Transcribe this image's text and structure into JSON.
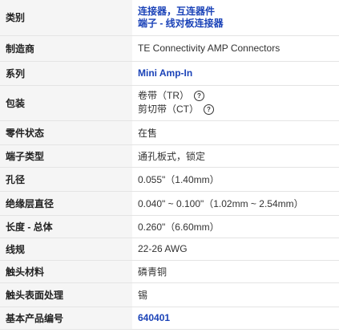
{
  "rows": [
    {
      "label": "类别",
      "links": [
        "连接器，互连器件",
        "端子 - 线对板连接器"
      ]
    },
    {
      "label": "制造商",
      "value": "TE Connectivity AMP Connectors"
    },
    {
      "label": "系列",
      "value": "Mini Amp-In"
    },
    {
      "label": "包装",
      "packaging": [
        "卷带（TR）",
        "剪切带（CT）"
      ],
      "help_icon": "question-circle-icon"
    },
    {
      "label": "零件状态",
      "value": "在售"
    },
    {
      "label": "端子类型",
      "value": "通孔板式，锁定"
    },
    {
      "label": "孔径",
      "value": "0.055\"（1.40mm）"
    },
    {
      "label": "绝缘层直径",
      "value": "0.040\" ~ 0.100\"（1.02mm ~ 2.54mm）"
    },
    {
      "label": "长度 - 总体",
      "value": "0.260\"（6.60mm）"
    },
    {
      "label": "线规",
      "value": "22-26 AWG"
    },
    {
      "label": "触头材料",
      "value": "磷青铜"
    },
    {
      "label": "触头表面处理",
      "value": "锡"
    },
    {
      "label": "基本产品编号",
      "value": "640401"
    }
  ],
  "colors": {
    "link": "#1b43b8",
    "label_bg": "#f5f5f5",
    "border": "#e4e4e4"
  }
}
